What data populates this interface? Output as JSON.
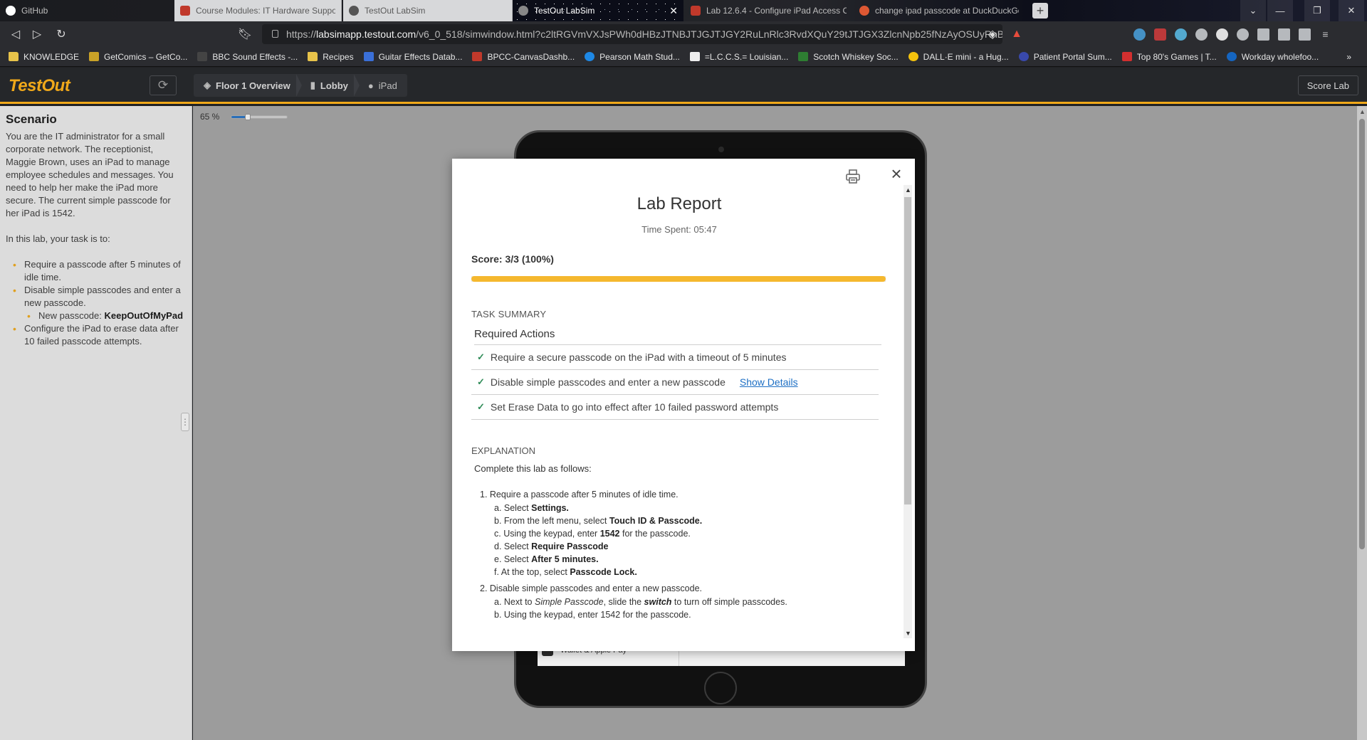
{
  "browser": {
    "tabs": [
      {
        "title": "GitHub",
        "state": "dark",
        "favicon_color": "#ffffff"
      },
      {
        "title": "Course Modules: IT Hardware Suppor",
        "state": "inactive",
        "favicon_color": "#c0392b"
      },
      {
        "title": "TestOut LabSim",
        "state": "inactive",
        "favicon_color": "#555555"
      },
      {
        "title": "TestOut LabSim",
        "state": "active",
        "favicon_color": "#888888"
      },
      {
        "title": "Lab 12.6.4 - Configure iPad Access Co",
        "state": "dark",
        "favicon_color": "#c0392b"
      },
      {
        "title": "change ipad passcode at DuckDuckGo",
        "state": "dark",
        "favicon_color": "#de5833"
      }
    ],
    "url_prefix": "https://",
    "url_host": "labsimapp.testout.com",
    "url_rest": "/v6_0_518/simwindow.html?c2ltRGVmVXJsPWh0dHBzJTNBJTJGJTJGY2RuLnRlc3RvdXQuY29tJTJGX3ZlcnNpb25fNzAyOSUyRnB...",
    "bookmarks": [
      {
        "label": "KNOWLEDGE",
        "kind": "folder"
      },
      {
        "label": "GetComics – GetCo...",
        "kind": "site",
        "color": "#c9a227"
      },
      {
        "label": "BBC Sound Effects -...",
        "kind": "site",
        "color": "#444444"
      },
      {
        "label": "Recipes",
        "kind": "folder"
      },
      {
        "label": "Guitar Effects Datab...",
        "kind": "site",
        "color": "#3a6fd8"
      },
      {
        "label": "BPCC-CanvasDashb...",
        "kind": "site",
        "color": "#c0392b"
      },
      {
        "label": "Pearson Math Stud...",
        "kind": "site",
        "color": "#1e88e5"
      },
      {
        "label": "=L.C.C.S.= Louisian...",
        "kind": "site",
        "color": "#eeeeee"
      },
      {
        "label": "Scotch Whiskey Soc...",
        "kind": "site",
        "color": "#2e7d32"
      },
      {
        "label": "DALL·E mini - a Hug...",
        "kind": "site",
        "color": "#f4c20d"
      },
      {
        "label": "Patient Portal Sum...",
        "kind": "site",
        "color": "#3949ab"
      },
      {
        "label": "Top 80's Games | T...",
        "kind": "site",
        "color": "#d32f2f"
      },
      {
        "label": "Workday wholefoo...",
        "kind": "site",
        "color": "#1565c0"
      }
    ]
  },
  "app": {
    "logo": "TestOut",
    "breadcrumbs": [
      {
        "label": "Floor 1 Overview",
        "icon": "layers-icon"
      },
      {
        "label": "Lobby",
        "icon": "door-icon"
      },
      {
        "label": "iPad",
        "icon": "apple-icon"
      }
    ],
    "score_button": "Score Lab",
    "zoom_label": "65 %",
    "zoom_fraction": 0.3
  },
  "scenario": {
    "heading": "Scenario",
    "intro": "You are the IT administrator for a small corporate network. The receptionist, Maggie Brown, uses an iPad to manage employee schedules and messages. You need to help her make the iPad more secure. The current simple passcode for her iPad is 1542.",
    "task_intro": "In this lab, your task is to:",
    "task1": "Require a passcode after 5 minutes of idle time.",
    "task2": "Disable simple passcodes and enter a new passcode.",
    "task2_sub_label": "New passcode: ",
    "task2_sub_value": "KeepOutOfMyPad",
    "task3": "Configure the iPad to erase data after 10 failed passcode attempts."
  },
  "ipad": {
    "visible_row": "Wallet & Apple Pay"
  },
  "report": {
    "title": "Lab Report",
    "time_spent": "Time Spent: 05:47",
    "score": "Score: 3/3 (100%)",
    "score_fraction": 1.0,
    "task_summary_heading": "TASK SUMMARY",
    "required_actions_heading": "Required Actions",
    "actions": [
      "Require a secure passcode on the iPad with a timeout of 5 minutes",
      "Disable simple passcodes and enter a new passcode",
      "Set Erase Data to go into effect after 10 failed password attempts"
    ],
    "show_details": "Show Details",
    "explanation_heading": "EXPLANATION",
    "explanation_intro": "Complete this lab as follows:",
    "step1": "1. Require a passcode after 5 minutes of idle time.",
    "step1a_pre": "a. Select ",
    "step1a_b": "Settings.",
    "step1b_pre": "b. From the left menu, select ",
    "step1b_b": "Touch ID & Passcode.",
    "step1c_pre": "c. Using the keypad, enter ",
    "step1c_b": "1542",
    "step1c_post": " for the passcode.",
    "step1d_pre": "d. Select ",
    "step1d_b": "Require Passcode",
    "step1e_pre": "e. Select ",
    "step1e_b": "After 5 minutes.",
    "step1f_pre": "f. At the top, select ",
    "step1f_b": "Passcode Lock.",
    "step2": "2. Disable simple passcodes and enter a new passcode.",
    "step2a_pre": "a. Next to ",
    "step2a_i": "Simple Passcode",
    "step2a_mid": ", slide the ",
    "step2a_b": "switch",
    "step2a_post": " to turn off simple passcodes.",
    "step2b_partial": "b. Using the keypad, enter 1542 for the passcode."
  }
}
